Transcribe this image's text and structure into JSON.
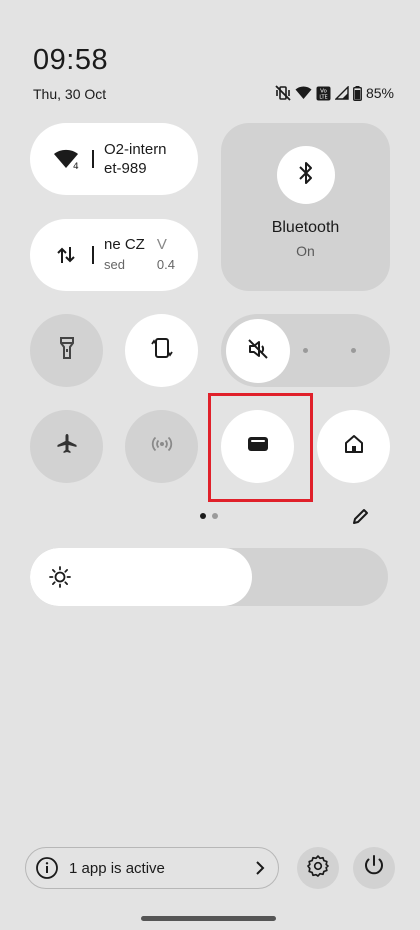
{
  "status_bar": {
    "time": "09:58",
    "date": "Thu, 30 Oct",
    "battery": "85%",
    "icons": [
      "vibrate-off-icon",
      "wifi-icon",
      "volte-icon",
      "signal-icon",
      "battery-icon"
    ],
    "volte_text": "Vo\nLTE"
  },
  "tiles": {
    "wifi": {
      "label": "O2-internet-989",
      "line1": "O2-intern",
      "line2": "et-989",
      "badge": "4",
      "icon": "wifi-icon"
    },
    "mobile_data": {
      "icon": "data-arrows-icon",
      "col1_name": "ne CZ",
      "col1_sub": "sed",
      "col2_name": "V",
      "col2_sub": "0.4"
    },
    "bluetooth": {
      "label": "Bluetooth",
      "state": "On",
      "icon": "bluetooth-icon"
    },
    "flashlight": {
      "icon": "flashlight-icon",
      "active": false
    },
    "auto_rotate": {
      "icon": "auto-rotate-icon",
      "active": true
    },
    "sound_mode": {
      "icon": "sound-off-icon",
      "selected_index": 0,
      "options": 3
    },
    "airplane": {
      "icon": "airplane-icon",
      "active": false
    },
    "hotspot": {
      "icon": "hotspot-icon",
      "active": false
    },
    "wallet": {
      "icon": "wallet-icon",
      "active": true
    },
    "home": {
      "icon": "home-icon",
      "active": true
    }
  },
  "pager": {
    "current": 1,
    "total": 2
  },
  "brightness": {
    "level": 0.62,
    "icon": "brightness-icon"
  },
  "footer": {
    "active_apps": "1 app is active",
    "icons": [
      "info-icon",
      "chevron-right-icon",
      "settings-icon",
      "power-icon"
    ]
  },
  "colors": {
    "background": "#e3e3e3",
    "tile_on": "#ffffff",
    "tile_off": "#d2d2d2",
    "highlight": "#e0202a"
  }
}
